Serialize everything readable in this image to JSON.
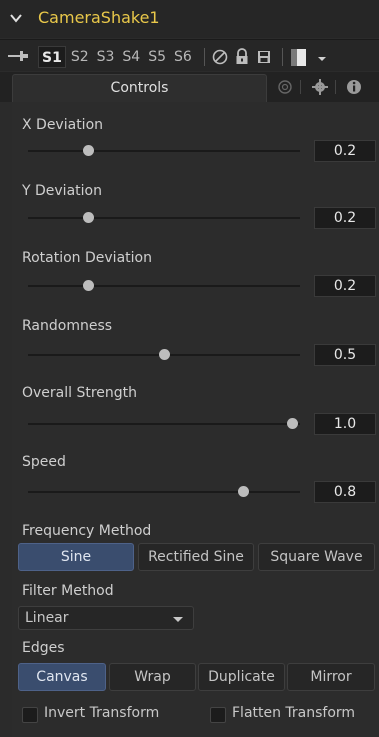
{
  "header": {
    "title": "CameraShake1",
    "chevron_icon": "chevron-down-icon"
  },
  "toolbar": {
    "slots": [
      "S1",
      "S2",
      "S3",
      "S4",
      "S5",
      "S6"
    ],
    "active_slot": "S1",
    "icons": [
      "pin-icon",
      "disable-icon",
      "lock-icon",
      "save-icon",
      "color-swatch-icon",
      "dropdown-arrow-icon"
    ]
  },
  "tabs": {
    "controls_label": "Controls",
    "icons": [
      "modifier-icon",
      "gear-icon",
      "info-icon"
    ]
  },
  "params": [
    {
      "label": "X Deviation",
      "value": "0.2",
      "fraction": 0.22
    },
    {
      "label": "Y Deviation",
      "value": "0.2",
      "fraction": 0.22
    },
    {
      "label": "Rotation Deviation",
      "value": "0.2",
      "fraction": 0.22
    },
    {
      "label": "Randomness",
      "value": "0.5",
      "fraction": 0.5
    },
    {
      "label": "Overall Strength",
      "value": "1.0",
      "fraction": 0.97
    },
    {
      "label": "Speed",
      "value": "0.8",
      "fraction": 0.79
    }
  ],
  "frequency": {
    "label": "Frequency Method",
    "options": [
      "Sine",
      "Rectified Sine",
      "Square Wave"
    ],
    "selected": "Sine"
  },
  "filter": {
    "label": "Filter Method",
    "value": "Linear"
  },
  "edges": {
    "label": "Edges",
    "options": [
      "Canvas",
      "Wrap",
      "Duplicate",
      "Mirror"
    ],
    "selected": "Canvas"
  },
  "checkboxes": [
    {
      "label": "Invert Transform",
      "checked": false
    },
    {
      "label": "Flatten Transform",
      "checked": false
    }
  ],
  "colors": {
    "title": "#e9c84a",
    "selected_button": "#3a4d6e",
    "background": "#2b2b2b"
  }
}
